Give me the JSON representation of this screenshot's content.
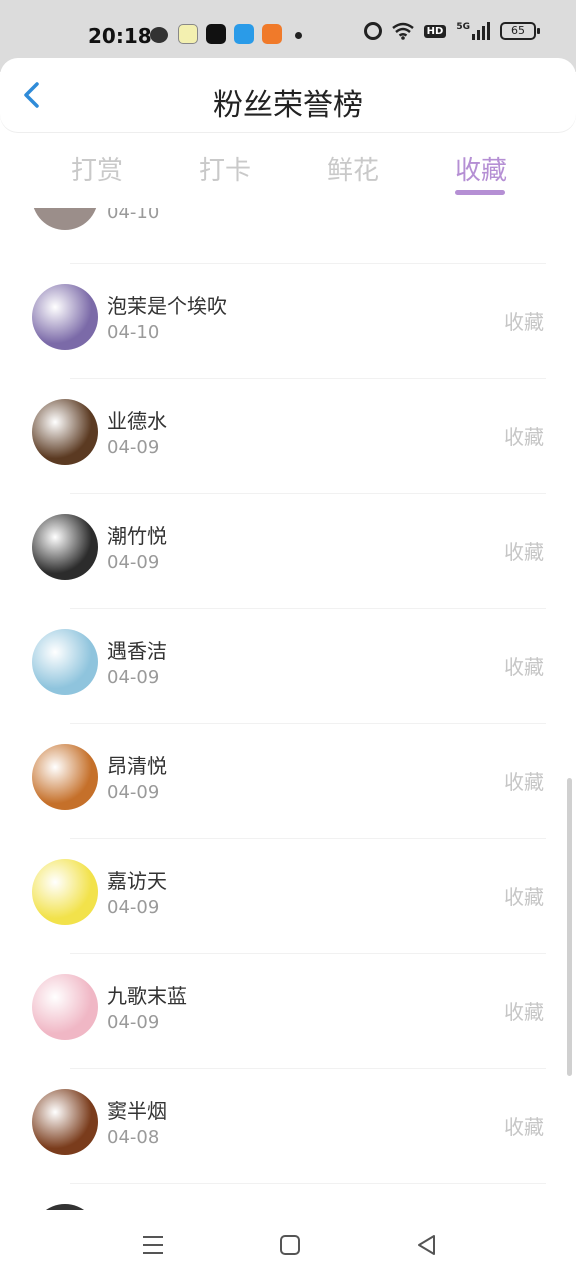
{
  "status_bar": {
    "time": "20:18",
    "wifi_label": "HD",
    "network": "5G",
    "battery": "65"
  },
  "header": {
    "title": "粉丝荣誉榜"
  },
  "tabs": [
    {
      "label": "打赏",
      "active": false
    },
    {
      "label": "打卡",
      "active": false
    },
    {
      "label": "鲜花",
      "active": false
    },
    {
      "label": "收藏",
      "active": true
    }
  ],
  "list": {
    "partial_top": {
      "date": "04-10"
    },
    "items": [
      {
        "name": "泡茉是个埃吹",
        "date": "04-10",
        "action": "收藏",
        "avatar_color": "#7b6aa8"
      },
      {
        "name": "业德水",
        "date": "04-09",
        "action": "收藏",
        "avatar_color": "#5b3a22"
      },
      {
        "name": "潮竹悦",
        "date": "04-09",
        "action": "收藏",
        "avatar_color": "#2c2c2c"
      },
      {
        "name": "遇香洁",
        "date": "04-09",
        "action": "收藏",
        "avatar_color": "#8fc4dd"
      },
      {
        "name": "昂清悦",
        "date": "04-09",
        "action": "收藏",
        "avatar_color": "#c5702a"
      },
      {
        "name": "嘉访天",
        "date": "04-09",
        "action": "收藏",
        "avatar_color": "#f2e24b"
      },
      {
        "name": "九歌末蓝",
        "date": "04-09",
        "action": "收藏",
        "avatar_color": "#f0b7c5"
      },
      {
        "name": "窦半烟",
        "date": "04-08",
        "action": "收藏",
        "avatar_color": "#7a3c1c"
      }
    ]
  },
  "nav": {
    "icons": [
      "menu-icon",
      "home-icon",
      "back-icon"
    ]
  },
  "colors": {
    "accent": "#b58fd4",
    "back_arrow": "#2f8bd8"
  }
}
